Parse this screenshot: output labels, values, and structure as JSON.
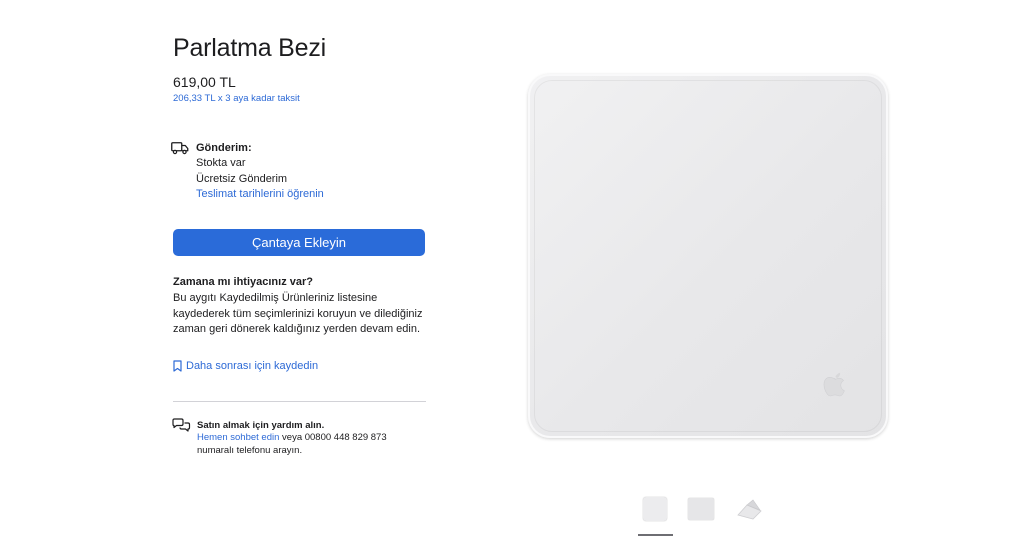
{
  "product": {
    "title": "Parlatma Bezi",
    "price": "619,00 TL",
    "installment": "206,33 TL x 3 aya kadar taksit"
  },
  "shipping": {
    "icon": "truck-icon",
    "title": "Gönderim:",
    "lines": [
      "Stokta var",
      "Ücretsiz Gönderim"
    ],
    "link": "Teslimat tarihlerini öğrenin"
  },
  "cta": {
    "label": "Çantaya Ekleyin",
    "color": "#2a6bd9"
  },
  "save": {
    "title": "Zamana mı ihtiyacınız var?",
    "body": "Bu aygıtı Kaydedilmiş Ürünleriniz listesine kaydederek tüm seçimlerinizi koruyun ve dilediğiniz zaman geri dönerek kaldığınız yerden devam edin.",
    "link": "Daha sonrası için kaydedin",
    "icon": "bookmark-icon"
  },
  "help": {
    "icon": "chat-bubbles-icon",
    "title": "Satın almak için yardım alın.",
    "link": "Hemen sohbet edin",
    "text_after_link": " veya 00800 448 829 873",
    "line2": "numaralı telefonu arayın."
  },
  "gallery": {
    "thumbnails": [
      "thumbnail-front",
      "thumbnail-angled",
      "thumbnail-folded"
    ],
    "selected_index": 0
  },
  "colors": {
    "link": "#2d6ad6",
    "text": "#1d1d1f"
  }
}
